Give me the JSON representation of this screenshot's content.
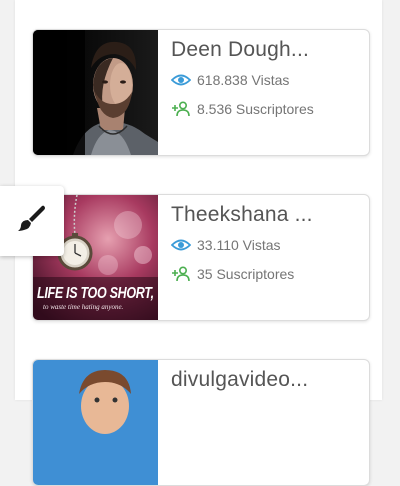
{
  "cards": [
    {
      "name": "Deen Dough...",
      "views": "618.838 Vistas",
      "subscribers": "8.536 Suscriptores"
    },
    {
      "name": "Theekshana ...",
      "views": "33.110 Vistas",
      "subscribers": "35 Suscriptores",
      "thumb_text_main": "LIFE IS TOO SHORT,",
      "thumb_text_sub": "to waste time hating anyone."
    },
    {
      "name": "divulgavideo..."
    }
  ],
  "colors": {
    "views_icon": "#3a9bd8",
    "subscribers_icon": "#4caf50",
    "name_text": "#555555",
    "stat_text": "#757575"
  },
  "icons": {
    "theme_button": "paint-brush-icon",
    "views": "eye-icon",
    "subscribers": "add-person-icon"
  }
}
